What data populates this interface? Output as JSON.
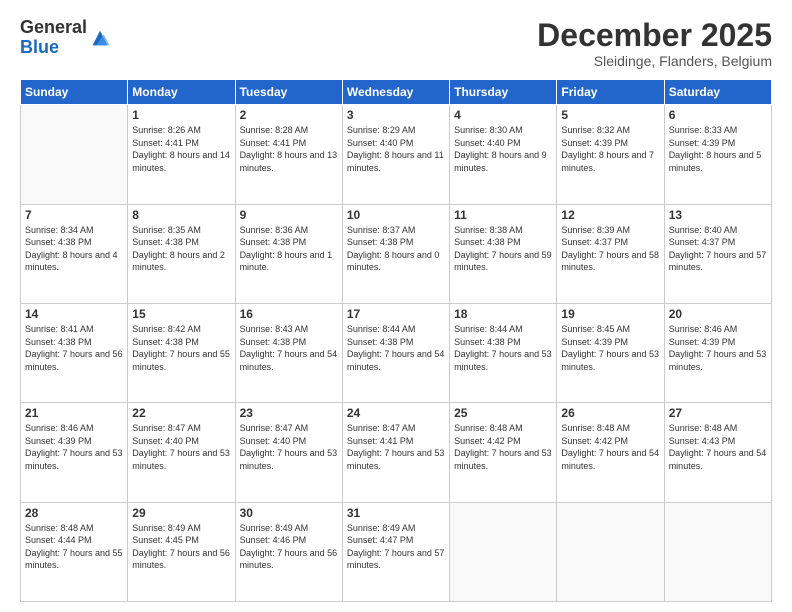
{
  "logo": {
    "general": "General",
    "blue": "Blue"
  },
  "header": {
    "month": "December 2025",
    "location": "Sleidinge, Flanders, Belgium"
  },
  "days_of_week": [
    "Sunday",
    "Monday",
    "Tuesday",
    "Wednesday",
    "Thursday",
    "Friday",
    "Saturday"
  ],
  "weeks": [
    [
      {
        "day": "",
        "sunrise": "",
        "sunset": "",
        "daylight": ""
      },
      {
        "day": "1",
        "sunrise": "Sunrise: 8:26 AM",
        "sunset": "Sunset: 4:41 PM",
        "daylight": "Daylight: 8 hours and 14 minutes."
      },
      {
        "day": "2",
        "sunrise": "Sunrise: 8:28 AM",
        "sunset": "Sunset: 4:41 PM",
        "daylight": "Daylight: 8 hours and 13 minutes."
      },
      {
        "day": "3",
        "sunrise": "Sunrise: 8:29 AM",
        "sunset": "Sunset: 4:40 PM",
        "daylight": "Daylight: 8 hours and 11 minutes."
      },
      {
        "day": "4",
        "sunrise": "Sunrise: 8:30 AM",
        "sunset": "Sunset: 4:40 PM",
        "daylight": "Daylight: 8 hours and 9 minutes."
      },
      {
        "day": "5",
        "sunrise": "Sunrise: 8:32 AM",
        "sunset": "Sunset: 4:39 PM",
        "daylight": "Daylight: 8 hours and 7 minutes."
      },
      {
        "day": "6",
        "sunrise": "Sunrise: 8:33 AM",
        "sunset": "Sunset: 4:39 PM",
        "daylight": "Daylight: 8 hours and 5 minutes."
      }
    ],
    [
      {
        "day": "7",
        "sunrise": "Sunrise: 8:34 AM",
        "sunset": "Sunset: 4:38 PM",
        "daylight": "Daylight: 8 hours and 4 minutes."
      },
      {
        "day": "8",
        "sunrise": "Sunrise: 8:35 AM",
        "sunset": "Sunset: 4:38 PM",
        "daylight": "Daylight: 8 hours and 2 minutes."
      },
      {
        "day": "9",
        "sunrise": "Sunrise: 8:36 AM",
        "sunset": "Sunset: 4:38 PM",
        "daylight": "Daylight: 8 hours and 1 minute."
      },
      {
        "day": "10",
        "sunrise": "Sunrise: 8:37 AM",
        "sunset": "Sunset: 4:38 PM",
        "daylight": "Daylight: 8 hours and 0 minutes."
      },
      {
        "day": "11",
        "sunrise": "Sunrise: 8:38 AM",
        "sunset": "Sunset: 4:38 PM",
        "daylight": "Daylight: 7 hours and 59 minutes."
      },
      {
        "day": "12",
        "sunrise": "Sunrise: 8:39 AM",
        "sunset": "Sunset: 4:37 PM",
        "daylight": "Daylight: 7 hours and 58 minutes."
      },
      {
        "day": "13",
        "sunrise": "Sunrise: 8:40 AM",
        "sunset": "Sunset: 4:37 PM",
        "daylight": "Daylight: 7 hours and 57 minutes."
      }
    ],
    [
      {
        "day": "14",
        "sunrise": "Sunrise: 8:41 AM",
        "sunset": "Sunset: 4:38 PM",
        "daylight": "Daylight: 7 hours and 56 minutes."
      },
      {
        "day": "15",
        "sunrise": "Sunrise: 8:42 AM",
        "sunset": "Sunset: 4:38 PM",
        "daylight": "Daylight: 7 hours and 55 minutes."
      },
      {
        "day": "16",
        "sunrise": "Sunrise: 8:43 AM",
        "sunset": "Sunset: 4:38 PM",
        "daylight": "Daylight: 7 hours and 54 minutes."
      },
      {
        "day": "17",
        "sunrise": "Sunrise: 8:44 AM",
        "sunset": "Sunset: 4:38 PM",
        "daylight": "Daylight: 7 hours and 54 minutes."
      },
      {
        "day": "18",
        "sunrise": "Sunrise: 8:44 AM",
        "sunset": "Sunset: 4:38 PM",
        "daylight": "Daylight: 7 hours and 53 minutes."
      },
      {
        "day": "19",
        "sunrise": "Sunrise: 8:45 AM",
        "sunset": "Sunset: 4:39 PM",
        "daylight": "Daylight: 7 hours and 53 minutes."
      },
      {
        "day": "20",
        "sunrise": "Sunrise: 8:46 AM",
        "sunset": "Sunset: 4:39 PM",
        "daylight": "Daylight: 7 hours and 53 minutes."
      }
    ],
    [
      {
        "day": "21",
        "sunrise": "Sunrise: 8:46 AM",
        "sunset": "Sunset: 4:39 PM",
        "daylight": "Daylight: 7 hours and 53 minutes."
      },
      {
        "day": "22",
        "sunrise": "Sunrise: 8:47 AM",
        "sunset": "Sunset: 4:40 PM",
        "daylight": "Daylight: 7 hours and 53 minutes."
      },
      {
        "day": "23",
        "sunrise": "Sunrise: 8:47 AM",
        "sunset": "Sunset: 4:40 PM",
        "daylight": "Daylight: 7 hours and 53 minutes."
      },
      {
        "day": "24",
        "sunrise": "Sunrise: 8:47 AM",
        "sunset": "Sunset: 4:41 PM",
        "daylight": "Daylight: 7 hours and 53 minutes."
      },
      {
        "day": "25",
        "sunrise": "Sunrise: 8:48 AM",
        "sunset": "Sunset: 4:42 PM",
        "daylight": "Daylight: 7 hours and 53 minutes."
      },
      {
        "day": "26",
        "sunrise": "Sunrise: 8:48 AM",
        "sunset": "Sunset: 4:42 PM",
        "daylight": "Daylight: 7 hours and 54 minutes."
      },
      {
        "day": "27",
        "sunrise": "Sunrise: 8:48 AM",
        "sunset": "Sunset: 4:43 PM",
        "daylight": "Daylight: 7 hours and 54 minutes."
      }
    ],
    [
      {
        "day": "28",
        "sunrise": "Sunrise: 8:48 AM",
        "sunset": "Sunset: 4:44 PM",
        "daylight": "Daylight: 7 hours and 55 minutes."
      },
      {
        "day": "29",
        "sunrise": "Sunrise: 8:49 AM",
        "sunset": "Sunset: 4:45 PM",
        "daylight": "Daylight: 7 hours and 56 minutes."
      },
      {
        "day": "30",
        "sunrise": "Sunrise: 8:49 AM",
        "sunset": "Sunset: 4:46 PM",
        "daylight": "Daylight: 7 hours and 56 minutes."
      },
      {
        "day": "31",
        "sunrise": "Sunrise: 8:49 AM",
        "sunset": "Sunset: 4:47 PM",
        "daylight": "Daylight: 7 hours and 57 minutes."
      },
      {
        "day": "",
        "sunrise": "",
        "sunset": "",
        "daylight": ""
      },
      {
        "day": "",
        "sunrise": "",
        "sunset": "",
        "daylight": ""
      },
      {
        "day": "",
        "sunrise": "",
        "sunset": "",
        "daylight": ""
      }
    ]
  ]
}
